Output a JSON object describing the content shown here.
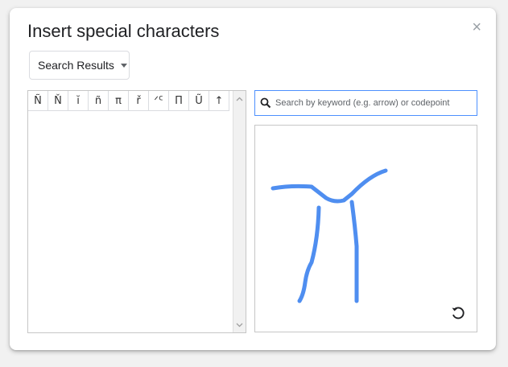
{
  "dialog": {
    "title": "Insert special characters",
    "close_icon": "×"
  },
  "category_dropdown": {
    "selected": "Search Results"
  },
  "results": {
    "characters": [
      "Ñ",
      "Ň",
      "ĭ",
      "ñ",
      "π",
      "ř",
      "ᐟᑦ",
      "Π",
      "Ũ",
      "↑"
    ]
  },
  "search": {
    "placeholder": "Search by keyword (e.g. arrow) or codepoint",
    "value": ""
  },
  "drawing": {
    "stroke_color": "#4f8ef0"
  },
  "colors": {
    "accent": "#4d90fe"
  }
}
